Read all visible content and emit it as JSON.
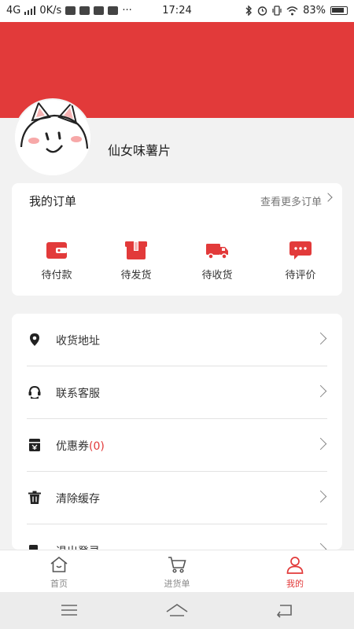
{
  "status_bar": {
    "network": "4G",
    "speed": "0K/s",
    "time": "17:24",
    "battery": "83%"
  },
  "profile": {
    "nickname": "仙女味薯片"
  },
  "orders": {
    "title": "我的订单",
    "more": "查看更多订单",
    "items": [
      {
        "label": "待付款",
        "icon": "wallet-icon"
      },
      {
        "label": "待发货",
        "icon": "package-icon"
      },
      {
        "label": "待收货",
        "icon": "truck-icon"
      },
      {
        "label": "待评价",
        "icon": "chat-icon"
      }
    ]
  },
  "menu": {
    "items": [
      {
        "label": "收货地址",
        "icon": "location-pin-icon"
      },
      {
        "label": "联系客服",
        "icon": "headset-icon"
      },
      {
        "label": "优惠券",
        "count": "(0)",
        "icon": "coupon-icon"
      },
      {
        "label": "清除缓存",
        "icon": "trash-icon"
      },
      {
        "label": "退出登录",
        "icon": "logout-icon"
      }
    ]
  },
  "tabbar": {
    "items": [
      {
        "label": "首页",
        "icon": "home-icon"
      },
      {
        "label": "进货单",
        "icon": "cart-icon"
      },
      {
        "label": "我的",
        "icon": "user-icon",
        "active": true
      }
    ]
  },
  "colors": {
    "accent": "#e23a3a",
    "background": "#f2f2f2"
  }
}
